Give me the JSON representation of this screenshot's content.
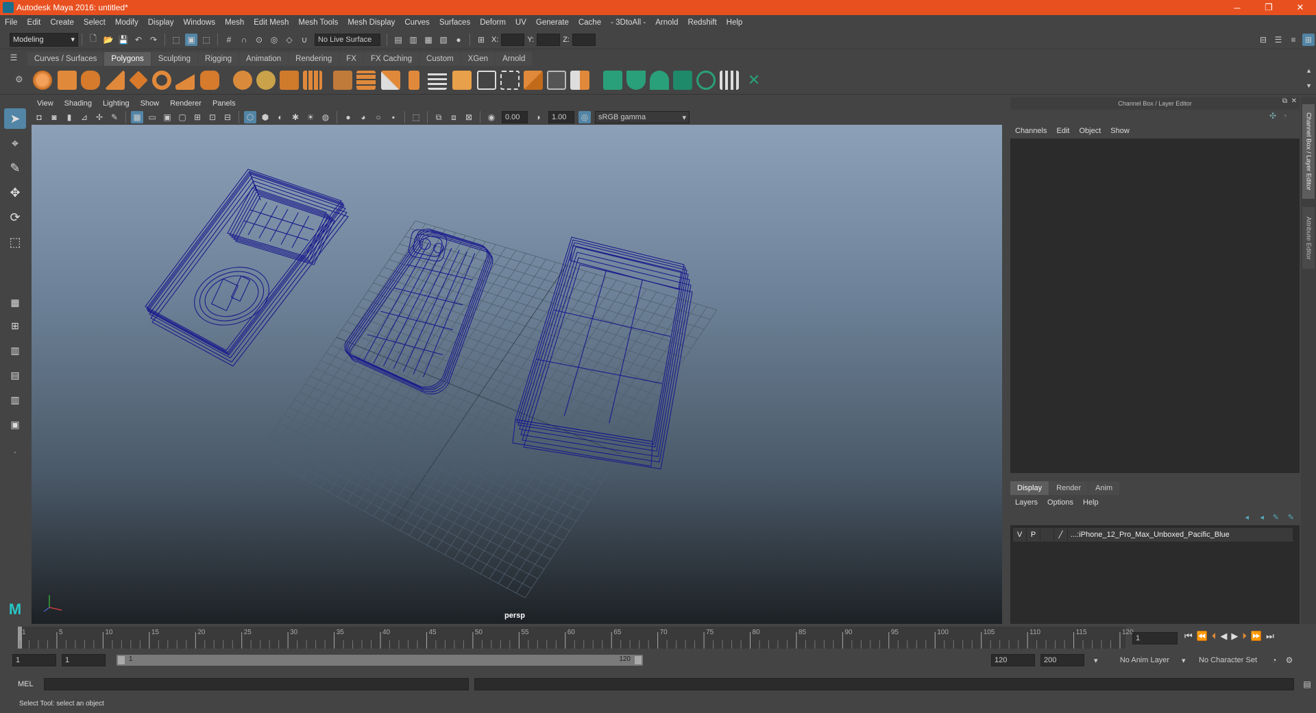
{
  "window": {
    "title": "Autodesk Maya 2016: untitled*",
    "minimize": "─",
    "maximize": "❐",
    "close": "✕"
  },
  "menubar": [
    "File",
    "Edit",
    "Create",
    "Select",
    "Modify",
    "Display",
    "Windows",
    "Mesh",
    "Edit Mesh",
    "Mesh Tools",
    "Mesh Display",
    "Curves",
    "Surfaces",
    "Deform",
    "UV",
    "Generate",
    "Cache",
    "- 3DtoAll -",
    "Arnold",
    "Redshift",
    "Help"
  ],
  "statusline": {
    "mode": "Modeling",
    "live_surface": "No Live Surface",
    "x_label": "X:",
    "y_label": "Y:",
    "z_label": "Z:"
  },
  "shelf_tabs": [
    "Curves / Surfaces",
    "Polygons",
    "Sculpting",
    "Rigging",
    "Animation",
    "Rendering",
    "FX",
    "FX Caching",
    "Custom",
    "XGen",
    "Arnold"
  ],
  "shelf_active_tab": "Polygons",
  "viewport": {
    "menu": [
      "View",
      "Shading",
      "Lighting",
      "Show",
      "Renderer",
      "Panels"
    ],
    "exposure": "0.00",
    "gamma": "1.00",
    "color_space": "sRGB gamma",
    "camera_label": "persp",
    "wire_color": "#1a1a8c"
  },
  "channel_box": {
    "title": "Channel Box / Layer Editor",
    "menu": [
      "Channels",
      "Edit",
      "Object",
      "Show"
    ]
  },
  "layer_editor": {
    "tabs": [
      "Display",
      "Render",
      "Anim"
    ],
    "active_tab": "Display",
    "menu": [
      "Layers",
      "Options",
      "Help"
    ],
    "layer": {
      "v": "V",
      "p": "P",
      "name": "...:iPhone_12_Pro_Max_Unboxed_Pacific_Blue"
    }
  },
  "side_tabs": {
    "channel": "Channel Box / Layer Editor",
    "attribute": "Attribute Editor"
  },
  "timeline": {
    "ticks": [
      "1",
      "5",
      "10",
      "15",
      "20",
      "25",
      "30",
      "35",
      "40",
      "45",
      "50",
      "55",
      "60",
      "65",
      "70",
      "75",
      "80",
      "85",
      "90",
      "95",
      "100",
      "105",
      "110",
      "115",
      "120"
    ],
    "current_frame": "1"
  },
  "range": {
    "start": "1",
    "start_inner": "1",
    "slider_start": "1",
    "slider_end": "120",
    "end_inner": "120",
    "end": "200",
    "anim_layer": "No Anim Layer",
    "char_set": "No Character Set"
  },
  "mel": {
    "label": "MEL"
  },
  "help_line": "Select Tool: select an object"
}
